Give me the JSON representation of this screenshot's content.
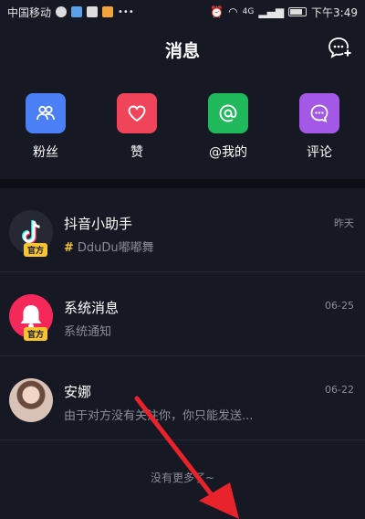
{
  "statusbar": {
    "carrier": "中国移动",
    "network": "4G",
    "time": "下午3:49"
  },
  "header": {
    "title": "消息"
  },
  "quick_actions": [
    {
      "label": "粉丝",
      "icon": "fans-icon",
      "color": "#4a7ff5"
    },
    {
      "label": "赞",
      "icon": "heart-icon",
      "color": "#f0445b"
    },
    {
      "label": "@我的",
      "icon": "at-icon",
      "color": "#1fb85b"
    },
    {
      "label": "评论",
      "icon": "comment-icon",
      "color": "#a459e6"
    }
  ],
  "messages": [
    {
      "name": "抖音小助手",
      "preview_tag": "#",
      "preview": "DduDu嘟嘟舞",
      "time": "昨天",
      "badge": "官方",
      "avatar": "tiktok-logo-avatar"
    },
    {
      "name": "系统消息",
      "preview": "系统通知",
      "time": "06-25",
      "badge": "官方",
      "avatar": "bell-avatar"
    },
    {
      "name": "安娜",
      "preview": "由于对方没有关注你，你只能发送...",
      "time": "06-22",
      "avatar": "user-photo-avatar"
    }
  ],
  "footer": {
    "no_more": "没有更多了~"
  },
  "colors": {
    "background": "#161823",
    "annotation_arrow": "#e8232b",
    "badge": "#f7c531"
  }
}
